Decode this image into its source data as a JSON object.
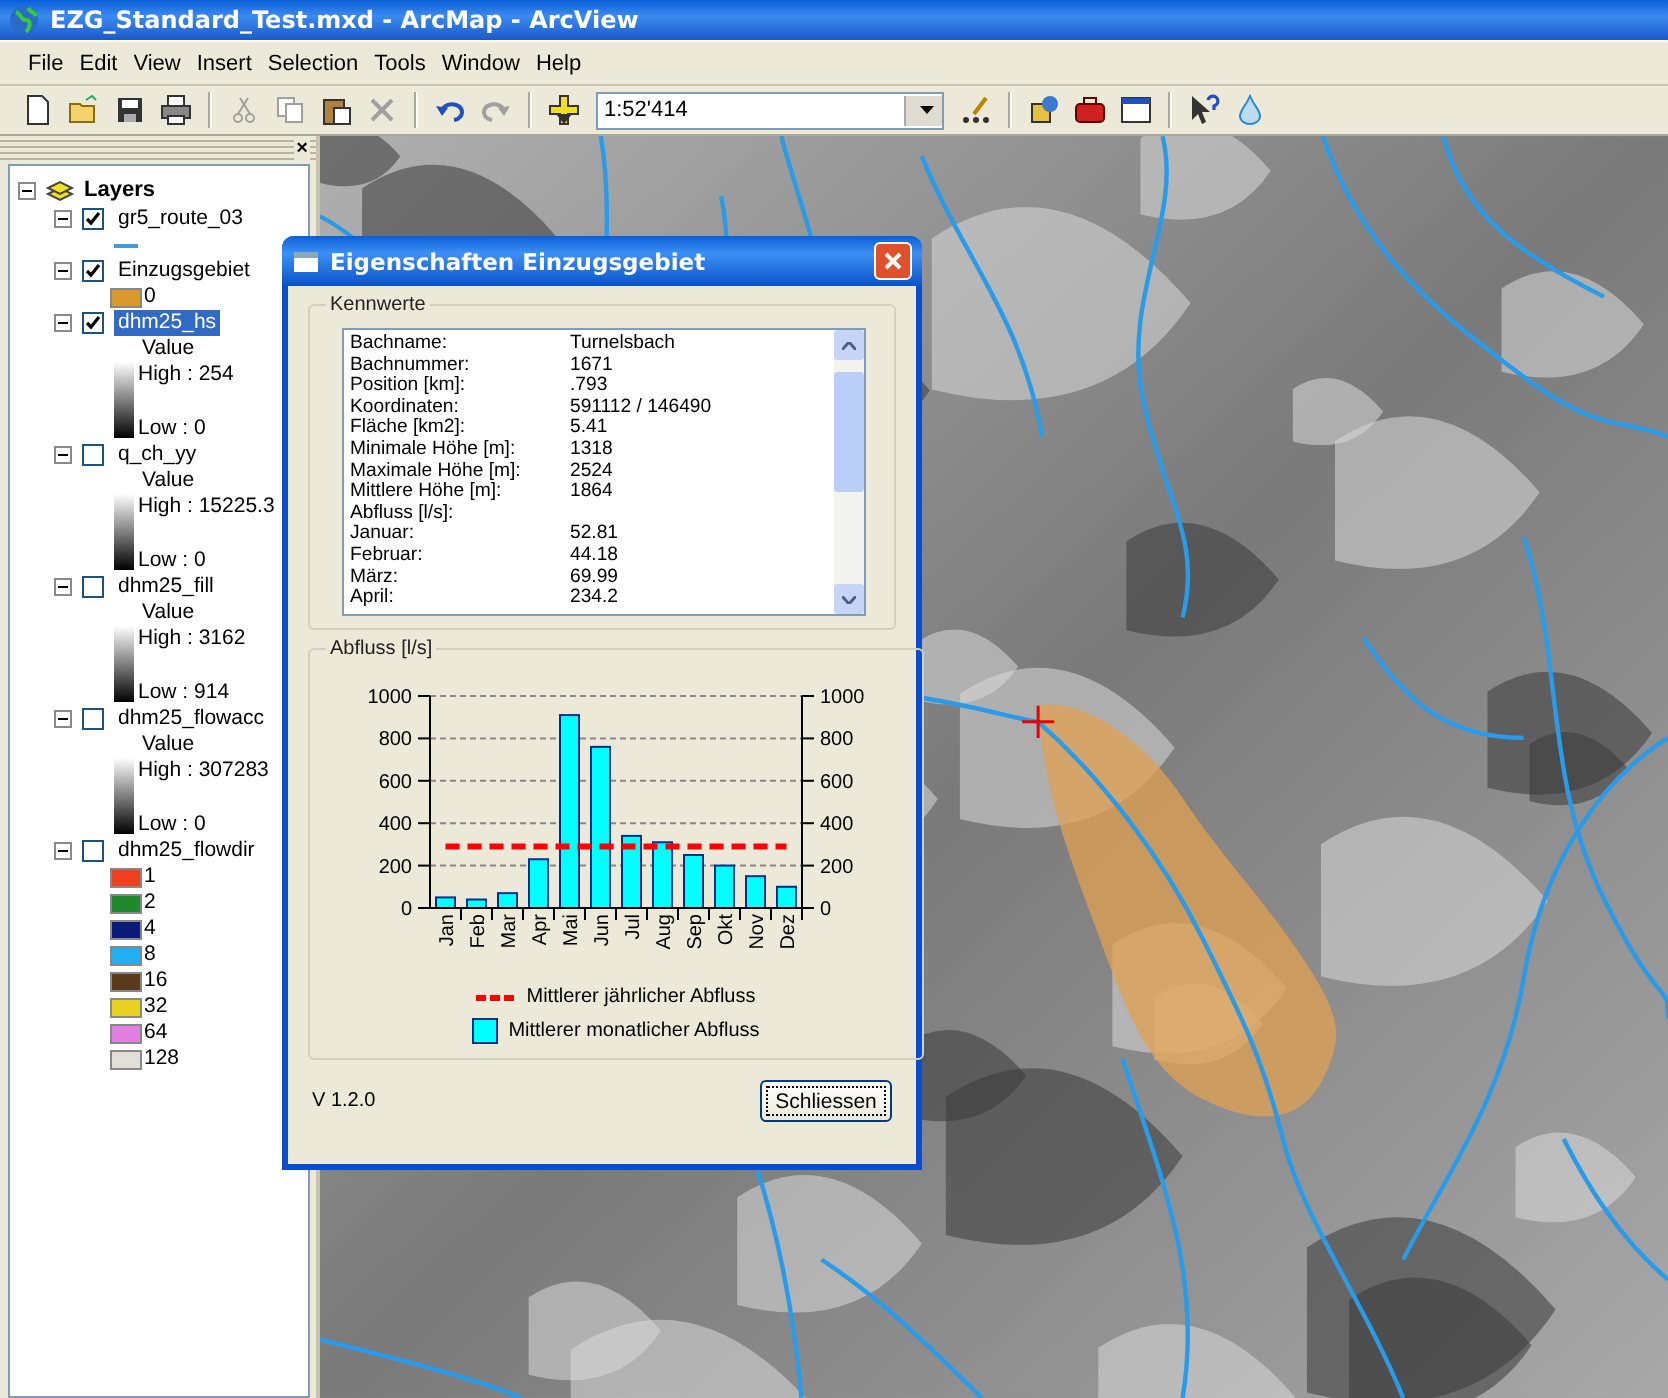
{
  "window": {
    "title": "EZG_Standard_Test.mxd - ArcMap - ArcView"
  },
  "menu": [
    {
      "label": "File"
    },
    {
      "label": "Edit"
    },
    {
      "label": "View"
    },
    {
      "label": "Insert"
    },
    {
      "label": "Selection"
    },
    {
      "label": "Tools"
    },
    {
      "label": "Window"
    },
    {
      "label": "Help"
    }
  ],
  "toolbar": {
    "left": [
      {
        "kind": "new",
        "disabled": false
      },
      {
        "kind": "open",
        "disabled": false
      },
      {
        "kind": "save",
        "disabled": false
      },
      {
        "kind": "print",
        "disabled": false
      },
      {
        "kind": "separator"
      },
      {
        "kind": "cut",
        "disabled": true
      },
      {
        "kind": "copy",
        "disabled": true
      },
      {
        "kind": "paste",
        "disabled": false
      },
      {
        "kind": "delete",
        "disabled": true
      },
      {
        "kind": "separator"
      },
      {
        "kind": "undo",
        "disabled": false
      },
      {
        "kind": "redo",
        "disabled": true
      },
      {
        "kind": "separator"
      },
      {
        "kind": "add-data",
        "disabled": false
      }
    ],
    "scale": "1:52'414",
    "right": [
      {
        "kind": "editor",
        "disabled": false
      },
      {
        "kind": "separator"
      },
      {
        "kind": "catalog",
        "disabled": false
      },
      {
        "kind": "toolbox",
        "disabled": false
      },
      {
        "kind": "window",
        "disabled": false
      },
      {
        "kind": "separator"
      },
      {
        "kind": "whats-this",
        "disabled": false
      },
      {
        "kind": "drop",
        "disabled": false
      }
    ]
  },
  "toc": {
    "close": "×",
    "title": "Layers",
    "expanded": true,
    "layers": [
      {
        "name": "gr5_route_03",
        "checked": true,
        "selected": false,
        "expanded": true,
        "legend": [
          {
            "kind": "line",
            "color": "#3d9be0"
          }
        ]
      },
      {
        "name": "Einzugsgebiet",
        "checked": true,
        "selected": false,
        "expanded": true,
        "legend": [
          {
            "kind": "fill",
            "label": "0",
            "color": "#d99a2b"
          }
        ]
      },
      {
        "name": "dhm25_hs",
        "checked": true,
        "selected": true,
        "expanded": true,
        "legend": [
          {
            "kind": "field",
            "label": "Value"
          },
          {
            "kind": "ramp",
            "high": "High : 254",
            "low": "Low : 0"
          }
        ]
      },
      {
        "name": "q_ch_yy",
        "checked": false,
        "selected": false,
        "expanded": true,
        "legend": [
          {
            "kind": "field",
            "label": "Value"
          },
          {
            "kind": "ramp",
            "high": "High : 15225.3",
            "low": "Low : 0"
          }
        ]
      },
      {
        "name": "dhm25_fill",
        "checked": false,
        "selected": false,
        "expanded": true,
        "legend": [
          {
            "kind": "field",
            "label": "Value"
          },
          {
            "kind": "ramp",
            "high": "High : 3162",
            "low": "Low : 914"
          }
        ]
      },
      {
        "name": "dhm25_flowacc",
        "checked": false,
        "selected": false,
        "expanded": true,
        "legend": [
          {
            "kind": "field",
            "label": "Value"
          },
          {
            "kind": "ramp",
            "high": "High : 307283",
            "low": "Low : 0"
          }
        ]
      },
      {
        "name": "dhm25_flowdir",
        "checked": false,
        "selected": false,
        "expanded": true,
        "legend": [
          {
            "kind": "fill",
            "label": "1",
            "color": "#f04020"
          },
          {
            "kind": "fill",
            "label": "2",
            "color": "#1e8a2e"
          },
          {
            "kind": "fill",
            "label": "4",
            "color": "#0a1a78"
          },
          {
            "kind": "fill",
            "label": "8",
            "color": "#22b0f0"
          },
          {
            "kind": "fill",
            "label": "16",
            "color": "#5a3a1a"
          },
          {
            "kind": "fill",
            "label": "32",
            "color": "#e8d020"
          },
          {
            "kind": "fill",
            "label": "64",
            "color": "#e080e0"
          },
          {
            "kind": "fill",
            "label": "128",
            "color": "#e0e0d8"
          }
        ]
      }
    ]
  },
  "dialog": {
    "title": "Eigenschaften Einzugsgebiet",
    "kennwerte": {
      "title": "Kennwerte",
      "rows": [
        {
          "label": "Bachname:",
          "value": "Turnelsbach"
        },
        {
          "label": "Bachnummer:",
          "value": "1671"
        },
        {
          "label": "Position [km]:",
          "value": ".793"
        },
        {
          "label": "Koordinaten:",
          "value": "591112 / 146490"
        },
        {
          "label": "Fläche [km2]:",
          "value": "5.41"
        },
        {
          "label": "Minimale Höhe [m]:",
          "value": "1318"
        },
        {
          "label": "Maximale Höhe [m]:",
          "value": "2524"
        },
        {
          "label": "Mittlere Höhe [m]:",
          "value": "1864"
        },
        {
          "label": "Abfluss [l/s]:"
        },
        {
          "label": "Januar:",
          "value": "52.81"
        },
        {
          "label": "Februar:",
          "value": "44.18"
        },
        {
          "label": "März:",
          "value": "69.99"
        },
        {
          "label": "April:",
          "value": "234.2"
        }
      ]
    },
    "abfluss": {
      "title": "Abfluss [l/s]",
      "chart_data": {
        "type": "bar",
        "categories": [
          "Jan",
          "Feb",
          "Mar",
          "Apr",
          "Mai",
          "Jun",
          "Jul",
          "Aug",
          "Sep",
          "Okt",
          "Nov",
          "Dez"
        ],
        "series": [
          {
            "name": "Mittlerer monatlicher Abfluss",
            "color": "#00ffff",
            "values": [
              50,
              40,
              70,
              230,
              910,
              760,
              340,
              310,
              250,
              200,
              150,
              100
            ]
          },
          {
            "name": "Mittlerer jährlicher Abfluss",
            "type": "line",
            "line_style": "dashed",
            "color": "#ff0000",
            "values": [
              290,
              290,
              290,
              290,
              290,
              290,
              290,
              290,
              290,
              290,
              290,
              290
            ]
          }
        ],
        "ylim": [
          0,
          1000
        ],
        "yticks": [
          0,
          200,
          400,
          600,
          800,
          1000
        ],
        "y2ticks": [
          0,
          200,
          400,
          600,
          800,
          1000
        ],
        "y2lim": [
          0,
          1000
        ],
        "grid": true
      }
    },
    "version": "V 1.2.0",
    "close_button": "Schliessen"
  }
}
